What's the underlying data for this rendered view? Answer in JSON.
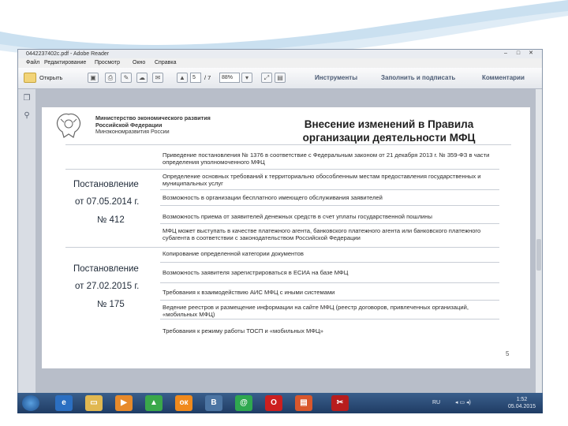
{
  "window": {
    "title": "0442237402c.pdf - Adobe Reader"
  },
  "menu": [
    "Файл",
    "Редактирование",
    "Просмотр",
    "Окно",
    "Справка"
  ],
  "toolbar": {
    "open_label": "Открыть",
    "page_current": "5",
    "page_total": "/ 7",
    "zoom": "88%",
    "tools_label": "Инструменты",
    "fill_sign_label": "Заполнить и подписать",
    "comments_label": "Комментарии"
  },
  "slide": {
    "ministry_line1": "Министерство экономического развития",
    "ministry_line2": "Российской Федерации",
    "ministry_line3": "Минэкономразвития России",
    "title_line1": "Внесение изменений в Правила",
    "title_line2": "организации деятельности МФЦ",
    "left_groups": [
      {
        "type": "Постановление",
        "date": "от 07.05.2014 г.",
        "number": "№ 412"
      },
      {
        "type": "Постановление",
        "date": "от 27.02.2015 г.",
        "number": "№ 175"
      }
    ],
    "rows": [
      "Приведение постановления № 1376 в соответствие с Федеральным законом от 21 декабря 2013 г. № 359-ФЗ в части определения уполномоченного МФЦ",
      "Определение основных требований к территориально обособленным местам предоставления государственных и муниципальных услуг",
      "Возможность в организации бесплатного имеющего обслуживания заявителей",
      "Возможность приема от заявителей денежных средств в счет уплаты государственной пошлины",
      "МФЦ может выступать в качестве платежного агента, банковского платежного агента или банковского платежного субагента в соответствии с законодательством Российской Федерации",
      "Копирование определенной категории документов",
      "Возможность заявителя зарегистрироваться в ЕСИА на базе МФЦ",
      "Требования к взаимодействию АИС МФЦ с иными системами",
      "Ведение реестров и размещение информации на сайте МФЦ (реестр договоров, привлеченных организаций, «мобильных МФЦ)",
      "Требования к режиму работы ТОСП и «мобильных МФЦ»"
    ],
    "page_number": "5"
  },
  "taskbar": {
    "apps": [
      "start",
      "ie",
      "explorer",
      "media",
      "play",
      "ok",
      "vk",
      "mail",
      "opera",
      "presentation",
      "pdf"
    ],
    "lang": "RU",
    "time": "1:52",
    "date": "05.04.2015",
    "ok_label": "ок",
    "vk_label": "В",
    "mail_label": "@"
  },
  "colors": {
    "flag_white": "#ffffff",
    "flag_blue": "#2f5fae",
    "flag_red": "#d9312c",
    "taskbar": "#27476f"
  }
}
